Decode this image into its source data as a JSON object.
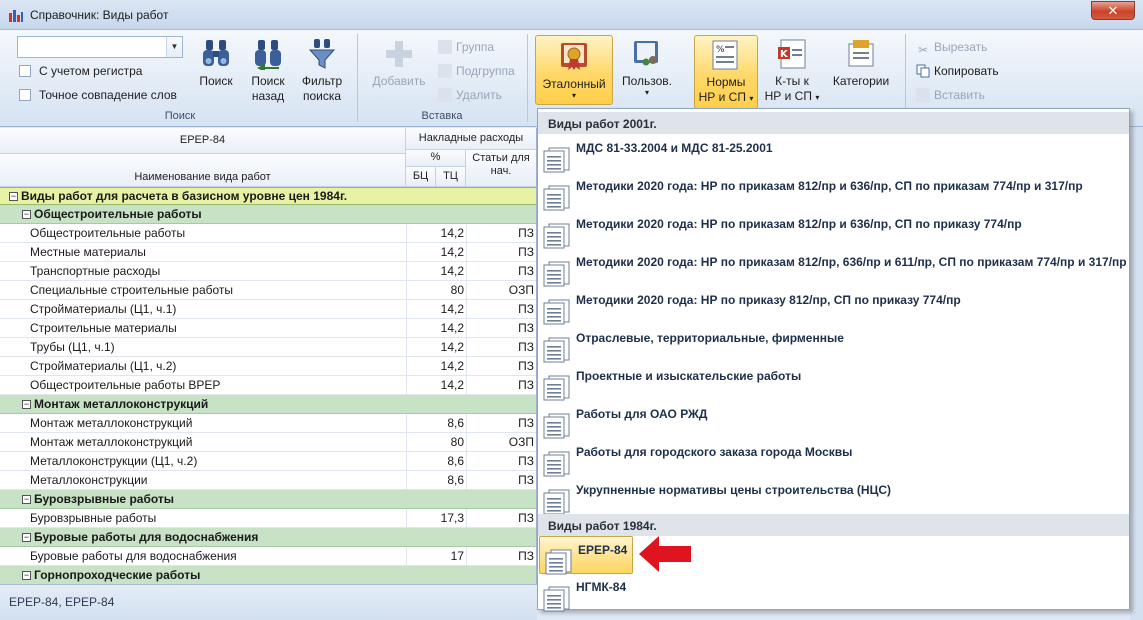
{
  "window": {
    "title": "Справочник: Виды работ",
    "close_glyph": "✕"
  },
  "ribbon": {
    "search_group": {
      "combo_value": "",
      "match_case_label": "С учетом регистра",
      "exact_match_label": "Точное совпадение слов",
      "search_label": "Поиск",
      "search_back_label_1": "Поиск",
      "search_back_label_2": "назад",
      "filter_label_1": "Фильтр",
      "filter_label_2": "поиска",
      "group_label": "Поиск"
    },
    "insert_group": {
      "add_label": "Добавить",
      "group_btn_label": "Группа",
      "subgroup_label": "Подгруппа",
      "delete_label": "Удалить",
      "group_label": "Вставка"
    },
    "views_group": {
      "etalon_label": "Эталонный",
      "user_label": "Пользов.",
      "norms_label_1": "Нормы",
      "norms_label_2": "НР и СП",
      "coef_label_1": "К-ты к",
      "coef_label_2": "НР и СП",
      "categories_label": "Категории",
      "caret": "▾"
    },
    "clipboard_group": {
      "cut_label": "Вырезать",
      "copy_label": "Копировать",
      "paste_label": "Вставить"
    }
  },
  "grid": {
    "title": "ЕРЕР-84",
    "name_header": "Наименование вида работ",
    "overhead_header": "Накладные расходы",
    "percent_header": "%",
    "articles_header": "Статьи для нач.",
    "bc_header": "БЦ",
    "tc_header": "ТЦ",
    "rows": [
      {
        "type": "g1",
        "name": "Виды работ для расчета в базисном уровне цен 1984г.",
        "toggle": "−"
      },
      {
        "type": "g2",
        "name": "Общестроительные работы",
        "toggle": "−"
      },
      {
        "type": "item",
        "name": "Общестроительные работы",
        "value": "14,2",
        "tc": "ПЗ"
      },
      {
        "type": "item",
        "name": "Местные материалы",
        "value": "14,2",
        "tc": "ПЗ"
      },
      {
        "type": "item",
        "name": "Транспортные расходы",
        "value": "14,2",
        "tc": "ПЗ"
      },
      {
        "type": "item",
        "name": "Специальные строительные работы",
        "value": "80",
        "tc": "ОЗП"
      },
      {
        "type": "item",
        "name": "Стройматериалы (Ц1, ч.1)",
        "value": "14,2",
        "tc": "ПЗ"
      },
      {
        "type": "item",
        "name": "Строительные материалы",
        "value": "14,2",
        "tc": "ПЗ"
      },
      {
        "type": "item",
        "name": "Трубы (Ц1, ч.1)",
        "value": "14,2",
        "tc": "ПЗ"
      },
      {
        "type": "item",
        "name": "Стройматериалы (Ц1, ч.2)",
        "value": "14,2",
        "tc": "ПЗ"
      },
      {
        "type": "item",
        "name": "Общестроительные работы ВРЕР",
        "value": "14,2",
        "tc": "ПЗ"
      },
      {
        "type": "g2",
        "name": "Монтаж металлоконструкций",
        "toggle": "−"
      },
      {
        "type": "item",
        "name": "Монтаж металлоконструкций",
        "value": "8,6",
        "tc": "ПЗ"
      },
      {
        "type": "item",
        "name": "Монтаж металлоконструкций",
        "value": "80",
        "tc": "ОЗП"
      },
      {
        "type": "item",
        "name": "Металлоконструкции (Ц1, ч.2)",
        "value": "8,6",
        "tc": "ПЗ"
      },
      {
        "type": "item",
        "name": "Металлоконструкции",
        "value": "8,6",
        "tc": "ПЗ"
      },
      {
        "type": "g2",
        "name": "Буровзрывные работы",
        "toggle": "−"
      },
      {
        "type": "item",
        "name": "Буровзрывные работы",
        "value": "17,3",
        "tc": "ПЗ"
      },
      {
        "type": "g2",
        "name": "Буровые работы для водоснабжения",
        "toggle": "−"
      },
      {
        "type": "item",
        "name": "Буровые работы для водоснабжения",
        "value": "17",
        "tc": "ПЗ"
      },
      {
        "type": "g2",
        "name": "Горнопроходческие работы",
        "toggle": "−"
      }
    ]
  },
  "status": {
    "text": "ЕРЕР-84, ЕРЕР-84"
  },
  "dropdown": {
    "section_2001": "Виды работ 2001г.",
    "section_1984": "Виды работ 1984г.",
    "items_2001": [
      "МДС 81-33.2004 и МДС 81-25.2001",
      "Методики 2020 года: НР по приказам 812/пр и 636/пр, СП по приказам 774/пр и 317/пр",
      "Методики 2020 года: НР по приказам 812/пр и 636/пр, СП по приказу 774/пр",
      "Методики 2020 года: НР по приказам 812/пр, 636/пр и 611/пр, СП по приказам 774/пр и 317/пр",
      "Методики 2020 года: НР по приказу 812/пр, СП по приказу 774/пр",
      "Отраслевые, территориальные, фирменные",
      "Проектные и изыскательские работы",
      "Работы для ОАО РЖД",
      "Работы для городского заказа города Москвы",
      "Укрупненные нормативы цены строительства (НЦС)"
    ],
    "items_1984": [
      "ЕРЕР-84",
      "НГМК-84"
    ],
    "selected": "ЕРЕР-84"
  },
  "colors": {
    "accent_red": "#e0141e",
    "highlight": "#ffd86a",
    "group_green": "#c8e2c6",
    "group_yellow": "#e8f2a5"
  },
  "icons": [
    "app-icon",
    "binoculars-icon",
    "binoculars-back-icon",
    "filter-icon",
    "add-icon",
    "book-icon",
    "users-book-icon",
    "norms-icon",
    "coef-icon",
    "categories-icon",
    "cut-icon",
    "copy-icon",
    "paste-icon",
    "document-icon",
    "arrow-icon"
  ]
}
